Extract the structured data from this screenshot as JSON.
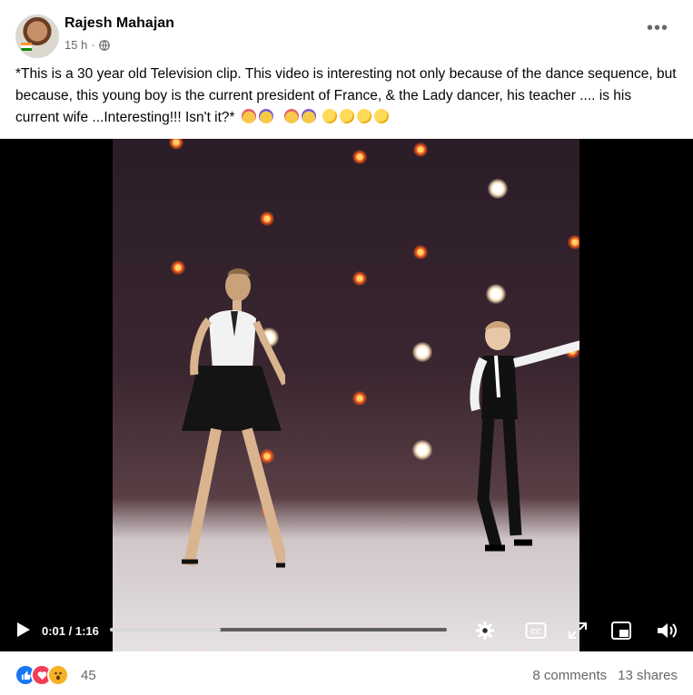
{
  "post": {
    "author": "Rajesh Mahajan",
    "time": "15 h",
    "separator": "·",
    "privacy_icon": "globe-icon",
    "more_icon": "more-options-icon",
    "more_label": "•••",
    "caption": "*This is a 30 year old Television clip. This video is interesting not only because of the dance sequence, but because, this young boy is the current president of France, & the Lady dancer, his teacher .... is his current wife ...Interesting!!! Isn't it?*",
    "caption_emojis": [
      "folded-hands-emoji",
      "folded-hands-emoji",
      "folded-hands-emoji",
      "folded-hands-emoji",
      "thinking-face-emoji",
      "thinking-face-emoji",
      "thinking-face-emoji",
      "thinking-face-emoji"
    ]
  },
  "video": {
    "current_time": "0:01",
    "duration": "1:16",
    "time_separator": " / ",
    "progress_fraction": 0.33,
    "controls": [
      "play-icon",
      "settings-icon",
      "captions-icon",
      "fullscreen-icon",
      "picture-in-picture-icon",
      "volume-icon"
    ]
  },
  "footer": {
    "reaction_icons": [
      "like-icon",
      "love-icon",
      "wow-icon"
    ],
    "reaction_count": "45",
    "comments": "8 comments",
    "shares": "13 shares"
  },
  "colors": {
    "secondary_text": "#65676b",
    "like_blue": "#1877f2",
    "love_red": "#f33e58",
    "wow_yellow": "#f7b125"
  }
}
